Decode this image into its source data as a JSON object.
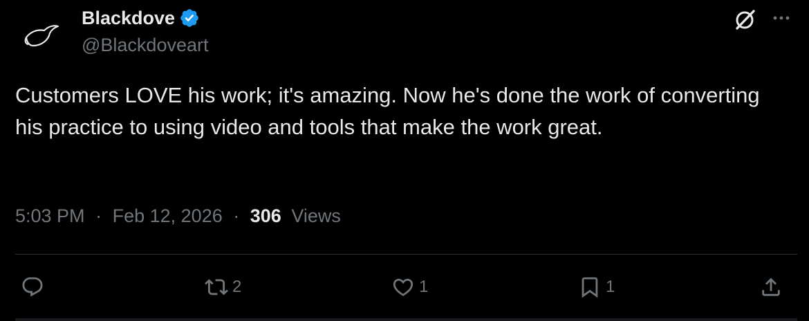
{
  "author": {
    "display_name": "Blackdove",
    "handle": "@Blackdoveart",
    "verified": true,
    "verified_color": "#1d9bf0",
    "avatar_icon": "dove-logo-icon"
  },
  "tweet": {
    "text": "Customers LOVE his work; it's amazing.  Now he's done the work of converting his practice to using video and tools that make the work great."
  },
  "meta": {
    "time": "5:03 PM",
    "separator": "·",
    "date": "Feb 12, 2026",
    "views_count": "306",
    "views_label": "Views"
  },
  "actions": {
    "reply_count": "",
    "retweet_count": "2",
    "like_count": "1",
    "bookmark_count": "1"
  },
  "colors": {
    "background": "#000000",
    "primary_text": "#e7e9ea",
    "secondary_text": "#71767b",
    "divider": "#2f3336"
  }
}
